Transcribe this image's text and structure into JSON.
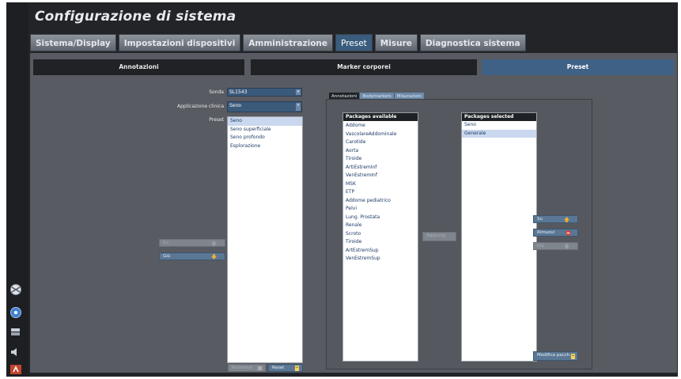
{
  "window": {
    "title": "Configurazione di sistema"
  },
  "main_tabs": [
    {
      "label": "Sistema/Display"
    },
    {
      "label": "Impostazioni dispositivi"
    },
    {
      "label": "Amministrazione"
    },
    {
      "label": "Preset"
    },
    {
      "label": "Misure"
    },
    {
      "label": "Diagnostica sistema"
    }
  ],
  "sub_tabs": [
    {
      "label": "Annotazioni"
    },
    {
      "label": "Marker corporei"
    },
    {
      "label": "Preset"
    }
  ],
  "form": {
    "sonda_label": "Sonda",
    "sonda_value": "SL1543",
    "applicazione_label": "Applicazione clinica",
    "applicazione_value": "Seno",
    "preset_label": "Preset"
  },
  "preset_list": [
    "Seno",
    "Seno superficiale",
    "Seno profondo",
    "Esplorazione"
  ],
  "left_buttons": {
    "up": "Su",
    "down": "Giù"
  },
  "bottom_buttons": {
    "rename": "Rinomina",
    "reset": "Reset"
  },
  "panel_tabs": [
    {
      "label": "Annotazioni"
    },
    {
      "label": "Bodymarkers"
    },
    {
      "label": "Misurazioni"
    }
  ],
  "packages_available": {
    "header": "Packages available",
    "items": [
      "Addome",
      "VascolareAddominale",
      "Carotide",
      "Aorta",
      "Tiroide",
      "ArtiEstremInf",
      "VenEstremInf",
      "MSK",
      "ETP",
      "Addome pediatrico",
      "Pelvi",
      "Lung. Prostata",
      "Renale",
      "Scroto",
      "Tiroide",
      "ArtEstremSup",
      "VenEstremSup"
    ]
  },
  "packages_selected": {
    "header": "Packages selected",
    "items": [
      "Seno",
      "Generale"
    ]
  },
  "middle_button": "Aggiungi",
  "right_buttons": {
    "up": "Su",
    "remove": "Rimuovi",
    "down": "Giù",
    "edit": "Modifica pacch."
  },
  "colors": {
    "accent": "#3f6185",
    "background": "#222428",
    "panel": "#585b61"
  }
}
